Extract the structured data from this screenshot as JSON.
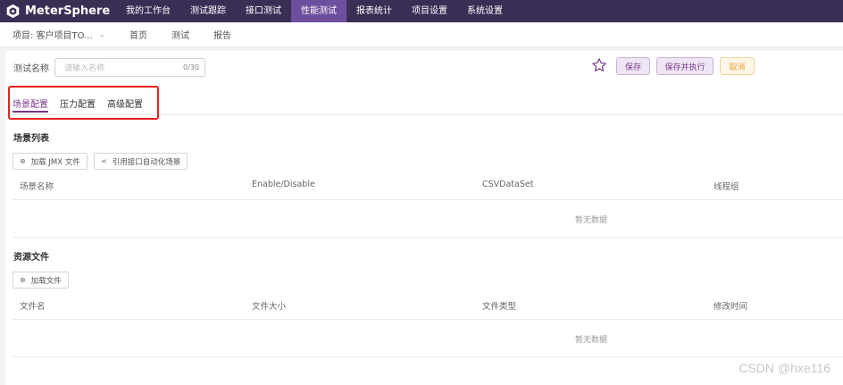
{
  "app": {
    "brand": "MeterSphere",
    "nav": [
      "我的工作台",
      "测试跟踪",
      "接口测试",
      "性能测试",
      "报表统计",
      "项目设置",
      "系统设置"
    ],
    "nav_active": "性能测试"
  },
  "subbar": {
    "project": "项目: 客户项目TO...",
    "links": [
      "首页",
      "测试",
      "报告"
    ]
  },
  "form": {
    "name_label": "测试名称",
    "name_placeholder": "请输入名称",
    "name_count": "0/30"
  },
  "actions": {
    "save": "保存",
    "save_exec": "保存并执行",
    "cancel": "取消"
  },
  "tabs": {
    "scene": "场景配置",
    "pressure": "压力配置",
    "advanced": "高级配置"
  },
  "scene_section": {
    "title": "场景列表",
    "load_jmx": "加载 JMX 文件",
    "ref_api": "引用接口自动化场景",
    "columns": [
      "场景名称",
      "Enable/Disable",
      "CSVDataSet",
      "线程组"
    ],
    "empty": "暂无数据"
  },
  "resource_section": {
    "title": "资源文件",
    "load_file": "加载文件",
    "columns": [
      "文件名",
      "文件大小",
      "文件类型",
      "修改时间"
    ],
    "empty": "暂无数据"
  },
  "watermark": "CSDN @hxe116",
  "colors": {
    "topbar": "#3a2e55",
    "accent": "#783887",
    "highlight": "#e8211d",
    "cancel": "#e6a23c"
  }
}
